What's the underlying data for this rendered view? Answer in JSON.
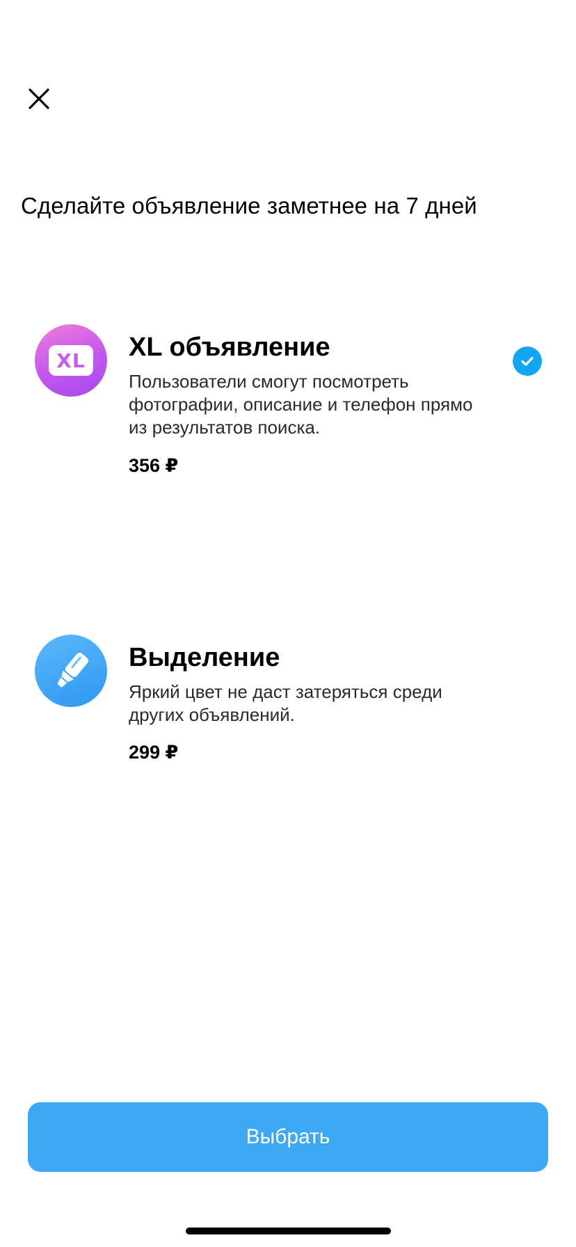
{
  "header": {
    "close_icon": "close-icon",
    "title": "Сделайте объявление заметнее на 7 дней"
  },
  "options": [
    {
      "icon": "xl-badge-icon",
      "icon_label": "XL",
      "title": "XL объявление",
      "description": "Пользователи смогут посмотреть фотографии, описание и телефон прямо из результатов поиска.",
      "price": "356 ₽",
      "selected": true,
      "icon_colors": [
        "#f07cd8",
        "#a748ec"
      ]
    },
    {
      "icon": "highlighter-icon",
      "title": "Выделение",
      "description": "Яркий цвет не даст затеряться среди других объявлений.",
      "price": "299 ₽",
      "selected": false,
      "icon_colors": [
        "#5cb8fb",
        "#2e97f3"
      ]
    }
  ],
  "footer": {
    "choose_label": "Выбрать"
  },
  "colors": {
    "accent": "#3ea9f2",
    "check": "#12a6f2"
  }
}
